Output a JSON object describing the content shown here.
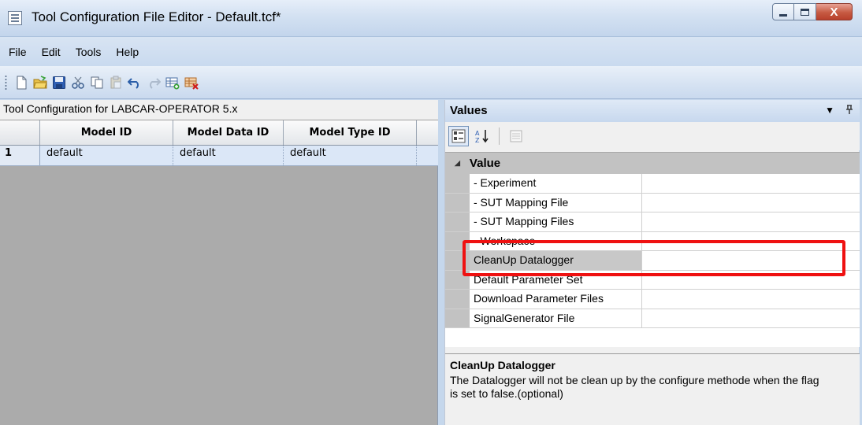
{
  "window": {
    "title": "Tool Configuration File Editor - Default.tcf*",
    "app_icon": "document-list-icon",
    "controls": {
      "minimize": "minimize-icon",
      "maximize": "maximize-icon",
      "close_label": "X"
    }
  },
  "menu": {
    "items": [
      {
        "label": "File"
      },
      {
        "label": "Edit"
      },
      {
        "label": "Tools"
      },
      {
        "label": "Help"
      }
    ]
  },
  "toolbar": {
    "icons": [
      "new-file-icon",
      "open-folder-icon",
      "save-icon",
      "cut-icon",
      "copy-icon",
      "paste-icon",
      "undo-icon",
      "redo-icon",
      "add-row-icon",
      "delete-row-icon"
    ]
  },
  "left": {
    "caption": "Tool Configuration for LABCAR-OPERATOR 5.x",
    "columns": [
      "",
      "Model ID",
      "Model Data ID",
      "Model Type ID"
    ],
    "rows": [
      {
        "num": "1",
        "model_id": "default",
        "model_data_id": "default",
        "model_type_id": "default"
      }
    ]
  },
  "values": {
    "header": "Values",
    "dropdown_glyph": "▼",
    "pin_glyph": "ᵖ",
    "category": "Value",
    "properties": [
      {
        "name": "- Experiment",
        "value": ""
      },
      {
        "name": "- SUT Mapping File",
        "value": ""
      },
      {
        "name": "- SUT Mapping Files",
        "value": ""
      },
      {
        "name": "- Workspace",
        "value": ""
      },
      {
        "name": "CleanUp Datalogger",
        "value": ""
      },
      {
        "name": "Default Parameter Set",
        "value": ""
      },
      {
        "name": "Download Parameter Files",
        "value": ""
      },
      {
        "name": "SignalGenerator File",
        "value": ""
      }
    ],
    "selected_property": "CleanUp Datalogger",
    "highlight_color": "#ef1111",
    "help": {
      "title": "CleanUp Datalogger",
      "description": "The Datalogger will not be clean up by the configure methode when the flag is set to false.(optional)"
    }
  }
}
